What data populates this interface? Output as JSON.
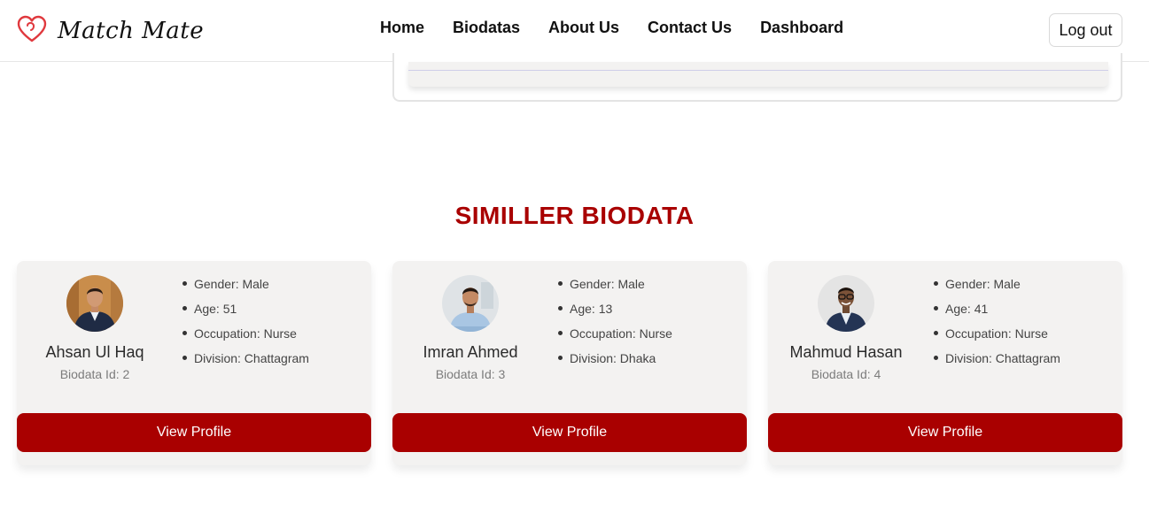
{
  "nav": {
    "brand": "Match Mate",
    "links": [
      "Home",
      "Biodatas",
      "About Us",
      "Contact Us",
      "Dashboard"
    ],
    "logout_label": "Log out",
    "accent": "#e0393e"
  },
  "section": {
    "title": "SIMILLER BIODATA",
    "title_color": "#a90000"
  },
  "cards": [
    {
      "name": "Ahsan Ul Haq",
      "biodata_id": "Biodata Id: 2",
      "gender": "Gender: Male",
      "age": "Age: 51",
      "occupation": "Occupation: Nurse",
      "division": "Division: Chattagram",
      "button": "View Profile"
    },
    {
      "name": "Imran Ahmed",
      "biodata_id": "Biodata Id: 3",
      "gender": "Gender: Male",
      "age": "Age: 13",
      "occupation": "Occupation: Nurse",
      "division": "Division: Dhaka",
      "button": "View Profile"
    },
    {
      "name": "Mahmud Hasan",
      "biodata_id": "Biodata Id: 4",
      "gender": "Gender: Male",
      "age": "Age: 41",
      "occupation": "Occupation: Nurse",
      "division": "Division: Chattagram",
      "button": "View Profile"
    }
  ],
  "colors": {
    "button": "#a90000",
    "card_bg": "#f3f2f1"
  }
}
